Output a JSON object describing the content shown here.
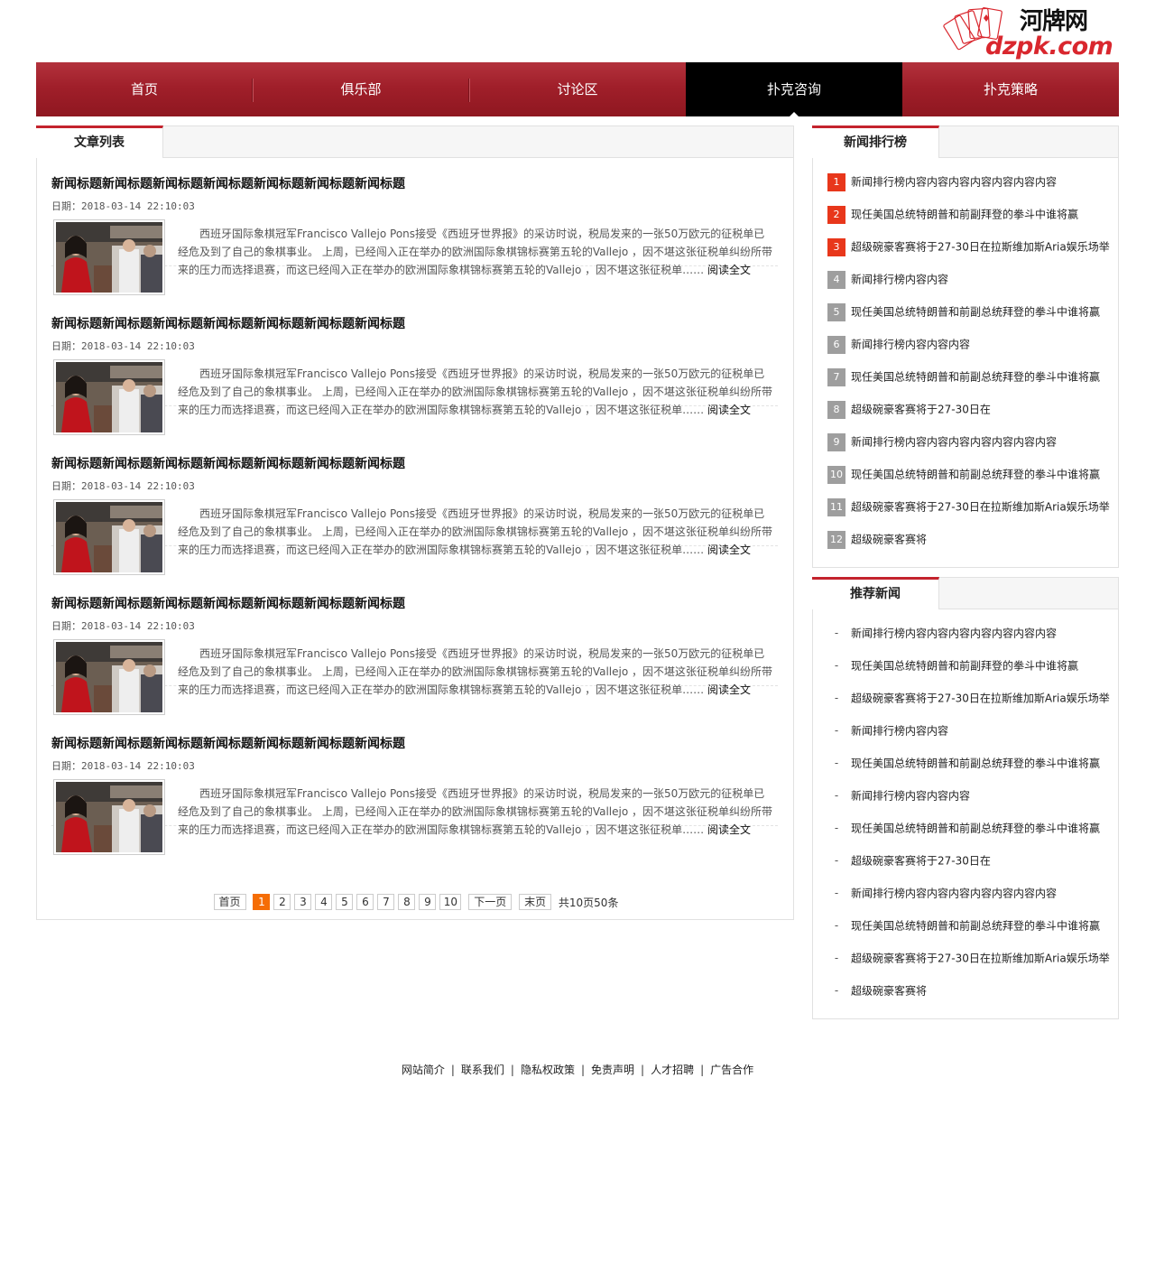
{
  "header": {
    "logo_cn": "河牌网",
    "logo_en": "dzpk.com"
  },
  "nav": {
    "items": [
      {
        "label": "首页"
      },
      {
        "label": "俱乐部"
      },
      {
        "label": "讨论区"
      },
      {
        "label": "扑克咨询",
        "active": true
      },
      {
        "label": "扑克策略"
      }
    ]
  },
  "main": {
    "tab_label": "文章列表",
    "articles": [
      {
        "title": "新闻标题新闻标题新闻标题新闻标题新闻标题新闻标题新闻标题",
        "date": "日期：2018-03-14 22:10:03",
        "body": "西班牙国际象棋冠军Francisco Vallejo Pons接受《西班牙世界报》的采访时说，税局发来的一张50万欧元的征税单已经危及到了自己的象棋事业。 上周，已经闯入正在举办的欧洲国际象棋锦标赛第五轮的Vallejo ，因不堪这张征税单纠纷所带来的压力而选择退赛，而这已经闯入正在举办的欧洲国际象棋锦标赛第五轮的Vallejo ，因不堪这张征税单……",
        "more": "阅读全文"
      },
      {
        "title": "新闻标题新闻标题新闻标题新闻标题新闻标题新闻标题新闻标题",
        "date": "日期：2018-03-14 22:10:03",
        "body": "西班牙国际象棋冠军Francisco Vallejo Pons接受《西班牙世界报》的采访时说，税局发来的一张50万欧元的征税单已经危及到了自己的象棋事业。 上周，已经闯入正在举办的欧洲国际象棋锦标赛第五轮的Vallejo ，因不堪这张征税单纠纷所带来的压力而选择退赛，而这已经闯入正在举办的欧洲国际象棋锦标赛第五轮的Vallejo ，因不堪这张征税单……",
        "more": "阅读全文"
      },
      {
        "title": "新闻标题新闻标题新闻标题新闻标题新闻标题新闻标题新闻标题",
        "date": "日期：2018-03-14 22:10:03",
        "body": "西班牙国际象棋冠军Francisco Vallejo Pons接受《西班牙世界报》的采访时说，税局发来的一张50万欧元的征税单已经危及到了自己的象棋事业。 上周，已经闯入正在举办的欧洲国际象棋锦标赛第五轮的Vallejo ，因不堪这张征税单纠纷所带来的压力而选择退赛，而这已经闯入正在举办的欧洲国际象棋锦标赛第五轮的Vallejo ，因不堪这张征税单……",
        "more": "阅读全文"
      },
      {
        "title": "新闻标题新闻标题新闻标题新闻标题新闻标题新闻标题新闻标题",
        "date": "日期：2018-03-14 22:10:03",
        "body": "西班牙国际象棋冠军Francisco Vallejo Pons接受《西班牙世界报》的采访时说，税局发来的一张50万欧元的征税单已经危及到了自己的象棋事业。 上周，已经闯入正在举办的欧洲国际象棋锦标赛第五轮的Vallejo ，因不堪这张征税单纠纷所带来的压力而选择退赛，而这已经闯入正在举办的欧洲国际象棋锦标赛第五轮的Vallejo ，因不堪这张征税单……",
        "more": "阅读全文"
      },
      {
        "title": "新闻标题新闻标题新闻标题新闻标题新闻标题新闻标题新闻标题",
        "date": "日期：2018-03-14 22:10:03",
        "body": "西班牙国际象棋冠军Francisco Vallejo Pons接受《西班牙世界报》的采访时说，税局发来的一张50万欧元的征税单已经危及到了自己的象棋事业。 上周，已经闯入正在举办的欧洲国际象棋锦标赛第五轮的Vallejo ，因不堪这张征税单纠纷所带来的压力而选择退赛，而这已经闯入正在举办的欧洲国际象棋锦标赛第五轮的Vallejo ，因不堪这张征税单……",
        "more": "阅读全文"
      }
    ],
    "pager": {
      "first": "首页",
      "pages": [
        "1",
        "2",
        "3",
        "4",
        "5",
        "6",
        "7",
        "8",
        "9",
        "10"
      ],
      "current": "1",
      "next": "下一页",
      "last": "末页",
      "total": "共10页50条"
    }
  },
  "ranking": {
    "tab_label": "新闻排行榜",
    "items": [
      {
        "rank": "1",
        "hot": true,
        "text": "新闻排行榜内容内容内容内容内容内容内容"
      },
      {
        "rank": "2",
        "hot": true,
        "text": "现任美国总统特朗普和前副拜登的拳斗中谁将赢"
      },
      {
        "rank": "3",
        "hot": true,
        "text": "超级碗豪客赛将于27-30日在拉斯维加斯Aria娱乐场举"
      },
      {
        "rank": "4",
        "hot": false,
        "text": "新闻排行榜内容内容"
      },
      {
        "rank": "5",
        "hot": false,
        "text": "现任美国总统特朗普和前副总统拜登的拳斗中谁将赢"
      },
      {
        "rank": "6",
        "hot": false,
        "text": "新闻排行榜内容内容内容"
      },
      {
        "rank": "7",
        "hot": false,
        "text": "现任美国总统特朗普和前副总统拜登的拳斗中谁将赢"
      },
      {
        "rank": "8",
        "hot": false,
        "text": "超级碗豪客赛将于27-30日在"
      },
      {
        "rank": "9",
        "hot": false,
        "text": "新闻排行榜内容内容内容内容内容内容内容"
      },
      {
        "rank": "10",
        "hot": false,
        "text": "现任美国总统特朗普和前副总统拜登的拳斗中谁将赢"
      },
      {
        "rank": "11",
        "hot": false,
        "text": "超级碗豪客赛将于27-30日在拉斯维加斯Aria娱乐场举"
      },
      {
        "rank": "12",
        "hot": false,
        "text": "超级碗豪客赛将"
      }
    ]
  },
  "recommend": {
    "tab_label": "推荐新闻",
    "bullet": "-",
    "items": [
      {
        "text": "新闻排行榜内容内容内容内容内容内容内容"
      },
      {
        "text": "现任美国总统特朗普和前副拜登的拳斗中谁将赢"
      },
      {
        "text": "超级碗豪客赛将于27-30日在拉斯维加斯Aria娱乐场举"
      },
      {
        "text": "新闻排行榜内容内容"
      },
      {
        "text": "现任美国总统特朗普和前副总统拜登的拳斗中谁将赢"
      },
      {
        "text": "新闻排行榜内容内容内容"
      },
      {
        "text": "现任美国总统特朗普和前副总统拜登的拳斗中谁将赢"
      },
      {
        "text": "超级碗豪客赛将于27-30日在"
      },
      {
        "text": "新闻排行榜内容内容内容内容内容内容内容"
      },
      {
        "text": "现任美国总统特朗普和前副总统拜登的拳斗中谁将赢"
      },
      {
        "text": "超级碗豪客赛将于27-30日在拉斯维加斯Aria娱乐场举"
      },
      {
        "text": "超级碗豪客赛将"
      }
    ]
  },
  "footer": {
    "links": [
      "网站简介",
      "联系我们",
      "隐私权政策",
      "免责声明",
      "人才招聘",
      "广告合作"
    ],
    "separator": "|"
  },
  "colors": {
    "brand_red": "#a01f2a",
    "active_nav": "#000000",
    "hot_badge": "#e8371b",
    "normal_badge": "#9e9e9e",
    "current_page": "#f56d05"
  }
}
